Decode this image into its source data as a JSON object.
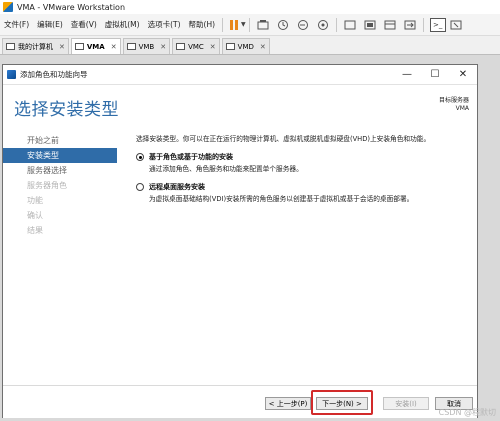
{
  "app": {
    "title": "VMA - VMware Workstation"
  },
  "menubar": {
    "items": [
      "文件(F)",
      "编辑(E)",
      "查看(V)",
      "虚拟机(M)",
      "选项卡(T)",
      "帮助(H)"
    ]
  },
  "tabs": [
    {
      "label": "我的计算机",
      "active": false
    },
    {
      "label": "VMA",
      "active": true
    },
    {
      "label": "VMB",
      "active": false
    },
    {
      "label": "VMC",
      "active": false
    },
    {
      "label": "VMD",
      "active": false
    }
  ],
  "wizard": {
    "window_title": "添加角色和功能向导",
    "heading": "选择安装类型",
    "destination_label": "目标服务器",
    "destination_value": "VMA",
    "steps": [
      {
        "label": "开始之前",
        "state": "normal"
      },
      {
        "label": "安装类型",
        "state": "active"
      },
      {
        "label": "服务器选择",
        "state": "normal"
      },
      {
        "label": "服务器角色",
        "state": "disabled"
      },
      {
        "label": "功能",
        "state": "disabled"
      },
      {
        "label": "确认",
        "state": "disabled"
      },
      {
        "label": "结果",
        "state": "disabled"
      }
    ],
    "description": "选择安装类型。你可以在正在运行的物理计算机、虚拟机或脱机虚拟硬盘(VHD)上安装角色和功能。",
    "options": [
      {
        "title": "基于角色或基于功能的安装",
        "desc": "通过添加角色、角色服务和功能来配置单个服务器。",
        "checked": true
      },
      {
        "title": "远程桌面服务安装",
        "desc": "为虚拟桌面基础结构(VDI)安装所需的角色服务以创建基于虚拟机或基于会话的桌面部署。",
        "checked": false
      }
    ],
    "buttons": {
      "prev": "< 上一步(P)",
      "next": "下一步(N) >",
      "install": "安装(I)",
      "cancel": "取消"
    }
  },
  "watermark": "CSDN @程默切",
  "colors": {
    "accent": "#2f6ca8",
    "highlight": "#d22a2a"
  }
}
